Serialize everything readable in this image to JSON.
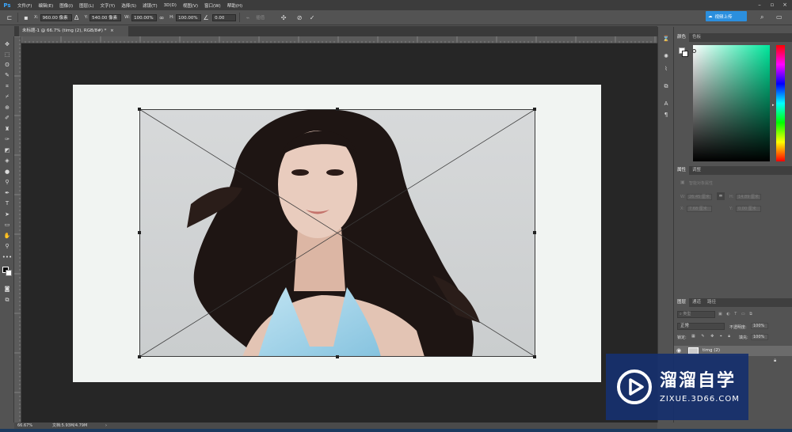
{
  "app": {
    "logo": "Ps"
  },
  "menu": [
    "文件(F)",
    "编辑(E)",
    "图像(I)",
    "图层(L)",
    "文字(Y)",
    "选择(S)",
    "滤镜(T)",
    "3D(D)",
    "视图(V)",
    "窗口(W)",
    "帮助(H)"
  ],
  "options": {
    "x_label": "X:",
    "x_value": "960.00 像素",
    "y_label": "Y:",
    "y_value": "540.00 像素",
    "w_label": "W:",
    "w_value": "100.00%",
    "h_label": "H:",
    "h_value": "100.00%",
    "angle_value": "0.00",
    "interp_label": "插值",
    "cloud_label": "视频上传"
  },
  "document": {
    "tab_title": "未标题-1 @ 66.7% (timg (2), RGB/8#) *"
  },
  "status": {
    "zoom": "66.67%",
    "doc_size": "文档:5.93M/4.79M"
  },
  "panels": {
    "color_tab": "颜色",
    "swatches_tab": "色板",
    "properties_tab": "属性",
    "adjustments_tab": "调整",
    "properties_title": "智能对象属性",
    "w_label": "W:",
    "w_value": "26.45 厘米",
    "h_label": "H:",
    "h_value": "14.89 厘米",
    "x_label": "X:",
    "x_value": "7.68 厘米",
    "y_label": "Y:",
    "y_value": "0.00 厘米",
    "layers_tab": "图层",
    "channels_tab": "通道",
    "paths_tab": "路径",
    "kind_label": "类型",
    "blend_mode": "正常",
    "opacity_label": "不透明度:",
    "opacity_value": "100%",
    "lock_label": "锁定:",
    "fill_label": "填充:",
    "fill_value": "100%",
    "layer_name": "timg (2)"
  },
  "watermark": {
    "brand": "溜溜自学",
    "url": "ZIXUE.3D66.COM"
  },
  "colors": {
    "accent": "#2b8fde",
    "panel": "#535353",
    "canvas": "#262626"
  }
}
